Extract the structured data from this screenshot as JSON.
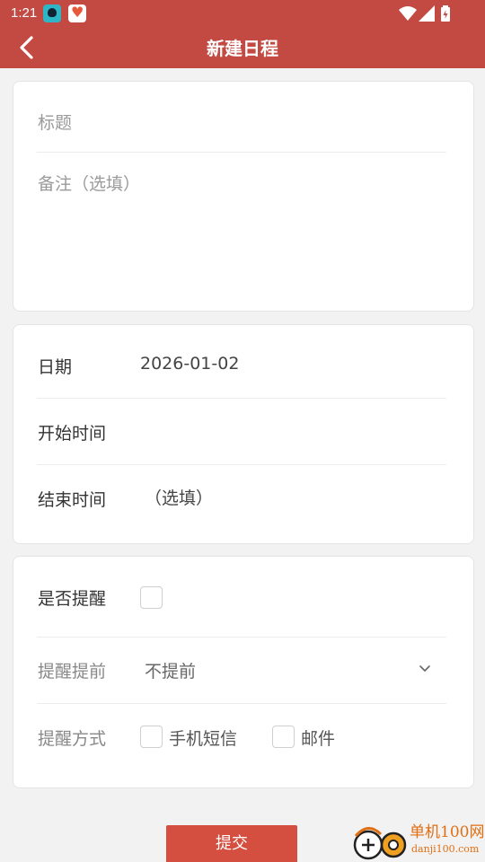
{
  "status_bar": {
    "time": "1:21"
  },
  "app_bar": {
    "title": "新建日程"
  },
  "basic": {
    "title_placeholder": "标题",
    "note_placeholder": "备注（选填）"
  },
  "schedule": {
    "date_label": "日期",
    "date_value": "2026-01-02",
    "start_label": "开始时间",
    "start_value": "",
    "end_label": "结束时间",
    "end_placeholder": "（选填）"
  },
  "reminder": {
    "enable_label": "是否提醒",
    "enabled": false,
    "advance_label": "提醒提前",
    "advance_value": "不提前",
    "method_label": "提醒方式",
    "methods": [
      {
        "label": "手机短信",
        "checked": false
      },
      {
        "label": "邮件",
        "checked": false
      }
    ]
  },
  "submit_label": "提交",
  "watermark": {
    "name": "单机100网",
    "url": "danji100.com"
  },
  "colors": {
    "accent": "#c24a43",
    "button": "#d44f3f"
  }
}
